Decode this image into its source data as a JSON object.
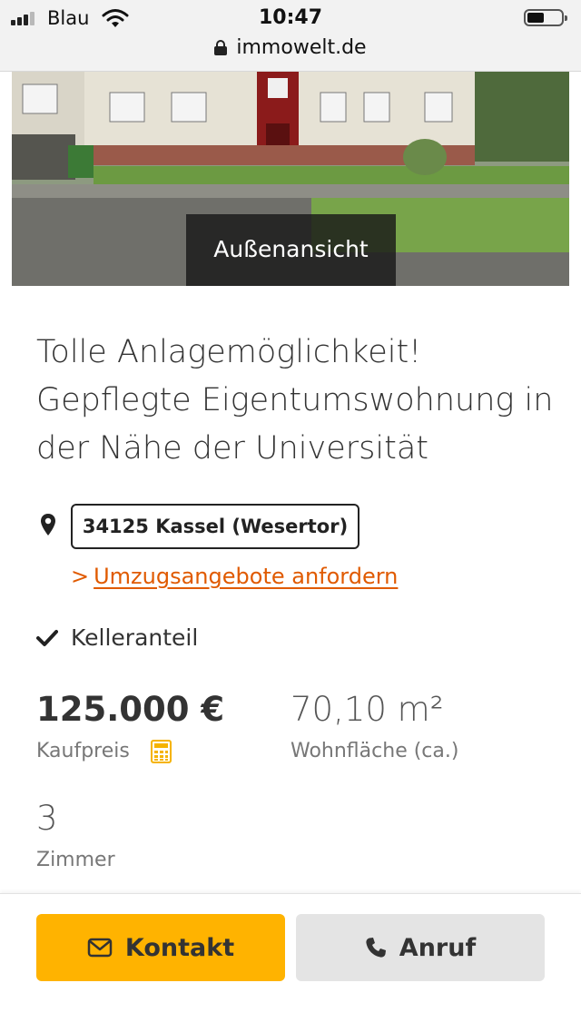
{
  "status_bar": {
    "carrier": "Blau",
    "time": "10:47"
  },
  "browser": {
    "url": "immowelt.de"
  },
  "listing": {
    "photo_caption": "Außenansicht",
    "title": "Tolle Anlagemöglichkeit! Gepflegte Eigentumswohnung in der Nähe der Universität",
    "location": "34125 Kassel (Wesertor)",
    "moving_offer_link": "Umzugsangebote anfordern",
    "moving_offer_chevron": ">",
    "feature": "Kelleranteil",
    "price": {
      "value": "125.000 €",
      "label": "Kaufpreis"
    },
    "area": {
      "value": "70,10 m²",
      "label": "Wohnfläche (ca.)"
    },
    "rooms": {
      "value": "3",
      "label": "Zimmer"
    }
  },
  "actions": {
    "contact_label": "Kontakt",
    "call_label": "Anruf"
  },
  "icons": {
    "signal": "signal-icon",
    "wifi": "wifi-icon",
    "battery": "battery-icon",
    "lock": "lock-icon",
    "location": "map-pin-icon",
    "check": "check-icon",
    "calculator": "calculator-icon",
    "mail": "envelope-icon",
    "phone": "phone-icon"
  },
  "colors": {
    "accent_orange": "#e05a00",
    "contact_button": "#ffb300",
    "call_button": "#e4e4e4",
    "calculator_icon": "#f5b300"
  }
}
